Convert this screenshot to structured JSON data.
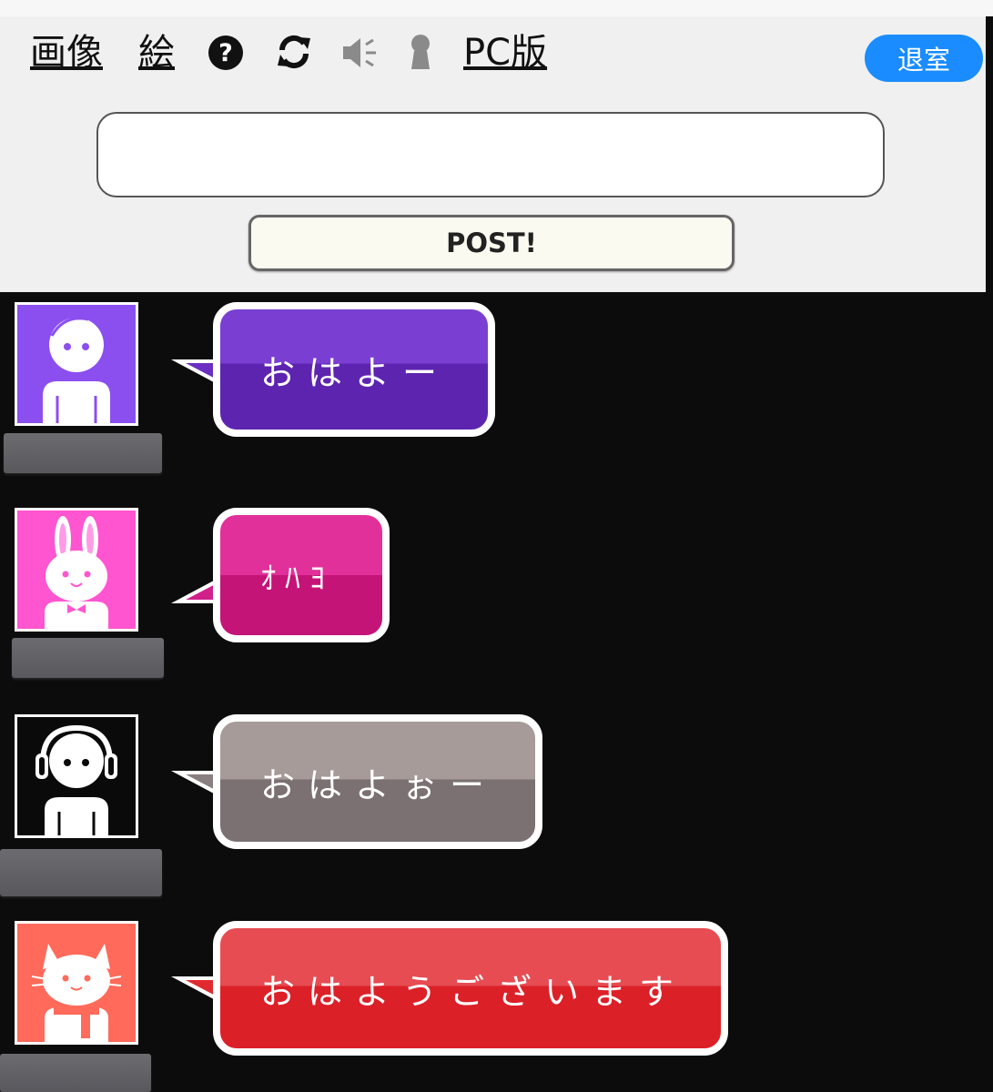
{
  "nav": {
    "image_label": "画像",
    "draw_label": "絵",
    "pc_label": "PC版",
    "icons": [
      "question-circle-icon",
      "refresh-icon",
      "speaker-icon",
      "user-silhouette-icon"
    ]
  },
  "leave_button_label": "退室",
  "message_input": {
    "value": "",
    "placeholder": ""
  },
  "post_button_label": "POST!",
  "colors": {
    "accent": "#1a8cff",
    "background": "#0c0c0c",
    "header": "#f0f0f0"
  },
  "messages": [
    {
      "text": "おはよー",
      "avatar": "boy-avatar",
      "color_top": "#7a3fd2",
      "color_bottom": "#5d24b0",
      "avatar_bg": "#8b4ff0"
    },
    {
      "text": "ｵﾊﾖ",
      "avatar": "rabbit-avatar",
      "color_top": "#e2309a",
      "color_bottom": "#c41478",
      "avatar_bg": "#ff55d0"
    },
    {
      "text": "おはよぉー",
      "avatar": "headphones-avatar",
      "color_top": "#a69b98",
      "color_bottom": "#7b7072",
      "avatar_bg": "#0a0a0a"
    },
    {
      "text": "おはようございます",
      "avatar": "cat-avatar",
      "color_top": "#e64c52",
      "color_bottom": "#dc2028",
      "avatar_bg": "#ff6a5a"
    }
  ]
}
